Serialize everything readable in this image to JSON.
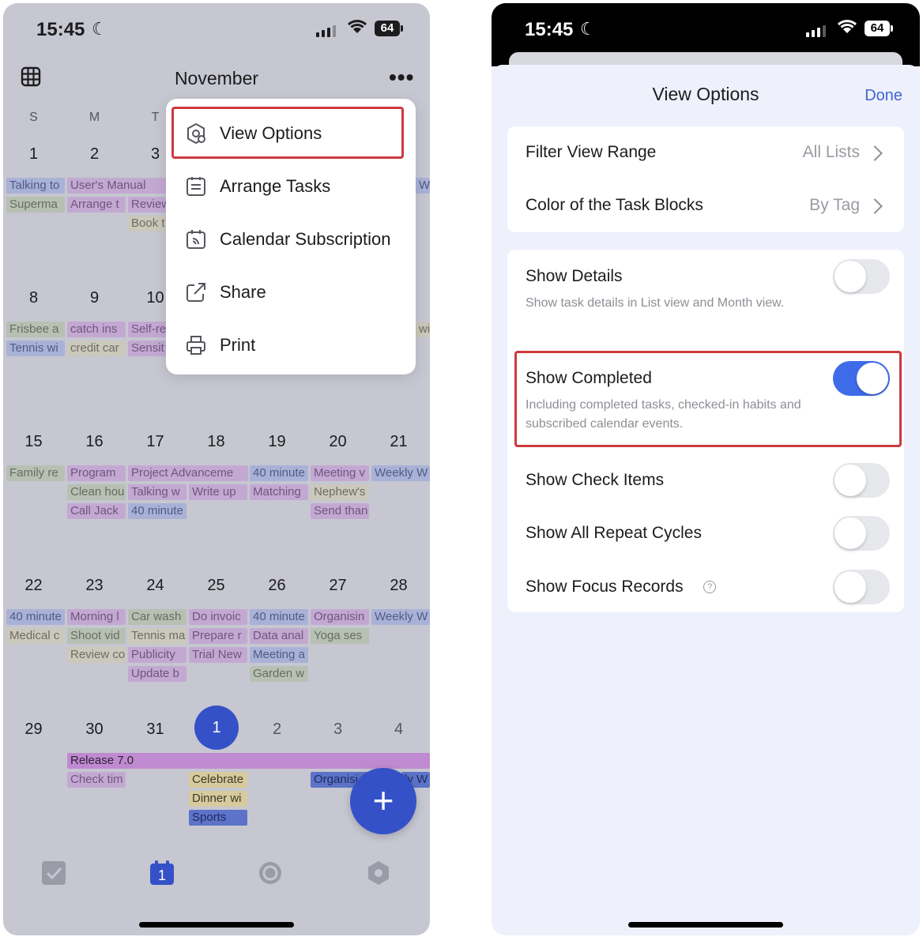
{
  "left": {
    "status": {
      "time": "15:45",
      "battery": "64"
    },
    "header": {
      "title": "November"
    },
    "weekdays": [
      "S",
      "M",
      "T"
    ],
    "weeks": [
      {
        "days": [
          "1",
          "2",
          "3"
        ]
      },
      {
        "days": [
          "8",
          "9",
          "10"
        ]
      },
      {
        "days": [
          "15",
          "16",
          "17",
          "18",
          "19",
          "20",
          "21"
        ]
      },
      {
        "days": [
          "22",
          "23",
          "24",
          "25",
          "26",
          "27",
          "28"
        ]
      },
      {
        "days": [
          "29",
          "30",
          "31",
          "1",
          "2",
          "3",
          "4"
        ]
      }
    ],
    "chips": {
      "w1": [
        "Talking to",
        "User's Manual",
        "W",
        "Superma",
        "Arrange t",
        "Review",
        "Book t"
      ],
      "w2": [
        "Frisbee a",
        "catch ins",
        "Self-re",
        "wi",
        "Tennis wi",
        "credit car",
        "Sensit"
      ],
      "w3": [
        "Family re",
        "Program",
        "Project Advanceme",
        "40 minute",
        "Meeting v",
        "Weekly W",
        "Clean hou",
        "Talking w",
        "Write up",
        "Matching",
        "Nephew's",
        "Call Jack",
        "40 minute",
        "Send than"
      ],
      "w4": [
        "40 minute",
        "Morning l",
        "Car wash",
        "Do invoic",
        "40 minute",
        "Organisin",
        "Weekly W",
        "Medical c",
        "Shoot vid",
        "Tennis ma",
        "Prepare r",
        "Data anal",
        "Yoga ses",
        "Review co",
        "Publicity",
        "Trial New",
        "Meeting a",
        "Update b",
        "Garden w"
      ],
      "w5": [
        "Release 7.0",
        "Check tim",
        "Celebrate",
        "Organisi",
        "ly W",
        "Dinner wi",
        "Sports"
      ]
    },
    "menu": {
      "items": [
        "View Options",
        "Arrange Tasks",
        "Calendar Subscription",
        "Share",
        "Print"
      ]
    },
    "tabs": {
      "calendar_badge": "1"
    },
    "colors": {
      "accent": "#3451c7",
      "highlight": "#cc3a3f"
    }
  },
  "right": {
    "status": {
      "time": "15:45",
      "battery": "64"
    },
    "title": "View Options",
    "done_label": "Done",
    "filter": {
      "label": "Filter View Range",
      "value": "All Lists"
    },
    "color": {
      "label": "Color of the Task Blocks",
      "value": "By Tag"
    },
    "toggles": [
      {
        "label": "Show Details",
        "description": "Show task details in List view and Month view.",
        "on": false
      },
      {
        "label": "Show Completed",
        "description": "Including completed tasks, checked-in habits and subscribed calendar events.",
        "on": true
      },
      {
        "label": "Show Check Items",
        "on": false
      },
      {
        "label": "Show All Repeat Cycles",
        "on": false
      },
      {
        "label": "Show Focus Records",
        "on": false
      }
    ],
    "help_glyph": "?",
    "colors": {
      "toggle_on": "#3e6be8",
      "done": "#3f66d6"
    }
  }
}
